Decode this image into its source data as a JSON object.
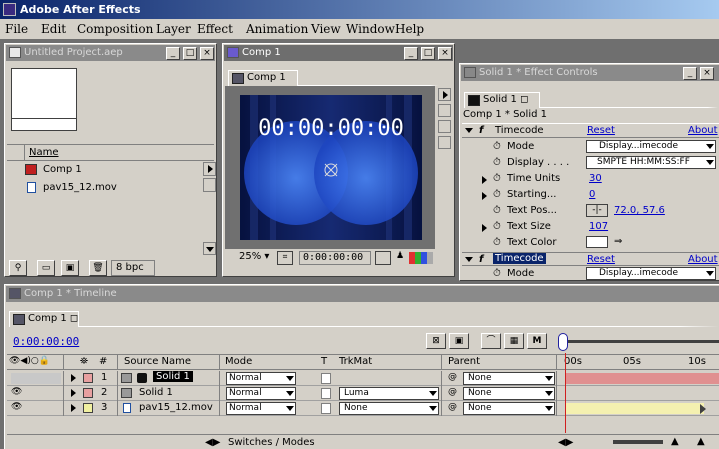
{
  "app": {
    "title": "Adobe After Effects"
  },
  "menu": [
    "File",
    "Edit",
    "Composition",
    "Layer",
    "Effect",
    "Animation",
    "View",
    "Window",
    "Help"
  ],
  "project": {
    "title": "Untitled Project.aep",
    "column_name": "Name",
    "items": [
      "Comp 1",
      "pav15_12.mov"
    ],
    "bpc": "8 bpc"
  },
  "comp": {
    "window_title": "Comp 1",
    "tab": "Comp 1",
    "timecode_overlay": "00:00:00:00",
    "zoom": "25%",
    "timecode": "0:00:00:00"
  },
  "effects": {
    "window_title": "Solid 1 * Effect Controls",
    "tab": "Solid 1",
    "breadcrumb": "Comp 1 * Solid 1",
    "effect1": {
      "name": "Timecode",
      "reset": "Reset",
      "about": "About",
      "props": [
        {
          "label": "Mode",
          "value": "Display...imecode"
        },
        {
          "label": "Display . . . .",
          "value": "SMPTE HH:MM:SS:FF"
        },
        {
          "label": "Time Units",
          "value": "30"
        },
        {
          "label": "Starting...",
          "value": "0"
        },
        {
          "label": "Text Pos...",
          "value": "72.0, 57.6"
        },
        {
          "label": "Text Size",
          "value": "107"
        },
        {
          "label": "Text Color",
          "value": ""
        }
      ]
    },
    "effect2": {
      "name": "Timecode",
      "reset": "Reset",
      "about": "About",
      "props": [
        {
          "label": "Mode",
          "value": "Display...imecode"
        }
      ]
    }
  },
  "timeline": {
    "window_title": "Comp 1 * Timeline",
    "tab": "Comp 1",
    "timecode": "0:00:00:00",
    "headers": {
      "num": "#",
      "source": "Source Name",
      "mode": "Mode",
      "t": "T",
      "trkmat": "TrkMat",
      "parent": "Parent"
    },
    "ruler": [
      "00s",
      "05s",
      "10s"
    ],
    "layers": [
      {
        "num": "1",
        "name": "Solid 1",
        "mode": "Normal",
        "trkmat": "",
        "parent": "None",
        "color": "#e8a0a0",
        "bar": "#e09090"
      },
      {
        "num": "2",
        "name": "Solid 1",
        "mode": "Normal",
        "trkmat": "Luma",
        "parent": "None",
        "color": "#e8a0a0",
        "bar": ""
      },
      {
        "num": "3",
        "name": "pav15_12.mov",
        "mode": "Normal",
        "trkmat": "None",
        "parent": "None",
        "color": "#f0f0a0",
        "bar": "#f4f0b0"
      }
    ],
    "switches_label": "Switches / Modes"
  }
}
